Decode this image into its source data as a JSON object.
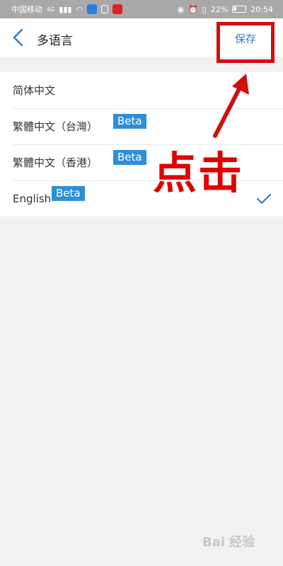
{
  "status_bar": {
    "carrier": "中国移动",
    "network": "4G",
    "battery": "22%",
    "time": "20:54"
  },
  "nav": {
    "title": "多语言",
    "save_label": "保存"
  },
  "languages": [
    {
      "label": "简体中文",
      "beta": "",
      "selected": false
    },
    {
      "label": "繁體中文（台灣）",
      "beta": "Beta",
      "selected": false
    },
    {
      "label": "繁體中文（香港）",
      "beta": "Beta",
      "selected": false
    },
    {
      "label": "English",
      "beta": "Beta",
      "selected": true
    }
  ],
  "annotation": {
    "text": "点击",
    "color": "#e00000"
  },
  "watermark": "Bai 经验",
  "colors": {
    "accent": "#2f7fd0",
    "beta_badge": "#2d8fd8",
    "status_bar": "#a9a9a9",
    "highlight_box": "#d01010"
  }
}
